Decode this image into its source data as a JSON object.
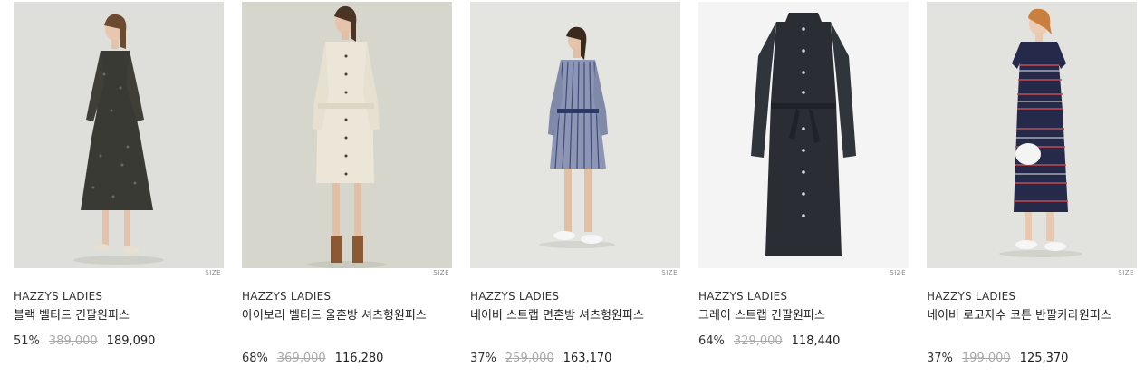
{
  "products": [
    {
      "size_label": "SIZE",
      "brand": "HAZZYS LADIES",
      "name": "블랙 벨티드 긴팔원피스",
      "discount": "51%",
      "original_price": "389,000",
      "sale_price": "189,090"
    },
    {
      "size_label": "SIZE",
      "brand": "HAZZYS LADIES",
      "name": "아이보리 벨티드 울혼방 셔츠형원피스",
      "discount": "68%",
      "original_price": "369,000",
      "sale_price": "116,280"
    },
    {
      "size_label": "SIZE",
      "brand": "HAZZYS LADIES",
      "name": "네이비 스트랩 면혼방 셔츠형원피스",
      "discount": "37%",
      "original_price": "259,000",
      "sale_price": "163,170"
    },
    {
      "size_label": "SIZE",
      "brand": "HAZZYS LADIES",
      "name": "그레이 스트랩 긴팔원피스",
      "discount": "64%",
      "original_price": "329,000",
      "sale_price": "118,440"
    },
    {
      "size_label": "SIZE",
      "brand": "HAZZYS LADIES",
      "name": "네이비 로고자수 코튼 반팔카라원피스",
      "discount": "37%",
      "original_price": "199,000",
      "sale_price": "125,370"
    }
  ],
  "colors": {
    "photo_bg": "#dcdcd6",
    "dress_black_floral": "#3a3a34",
    "dress_ivory": "#ece6d8",
    "dress_stripe": "#5b6a8e",
    "dress_charcoal": "#2a2d33",
    "dress_navy_stripe": "#262a4a"
  }
}
